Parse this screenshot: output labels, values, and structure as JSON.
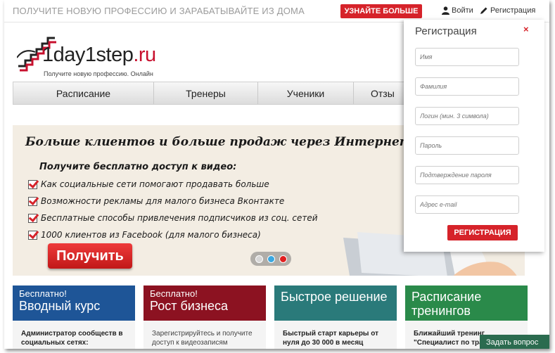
{
  "topbar": {
    "tagline": "ПОЛУЧИТЕ НОВУЮ ПРОФЕССИЮ И ЗАРАБАТЫВАЙТЕ ИЗ ДОМА",
    "cta_label": "УЗНАЙТЕ БОЛЬШЕ",
    "login_label": "Войти",
    "register_label": "Регистрация"
  },
  "logo": {
    "brand_main": "1day1step",
    "brand_suffix": ".ru",
    "slogan": "Получите новую профессию. Онлайн"
  },
  "nav": {
    "items": [
      "Расписание",
      "Тренеры",
      "Ученики",
      "Отзы"
    ]
  },
  "banner": {
    "headline": "Больше клиентов и больше продаж через Интернет",
    "subheadline": "Получите бесплатно доступ к видео:",
    "bullets": [
      "Как социальные сети помогают продавать больше",
      "Возможности рекламы для малого бизнеса Вконтакте",
      "Бесплатные способы привлечения подписчиков из соц. сетей",
      "1000 клиентов из Facebook (для малого бизнеса)"
    ],
    "button_label": "Получить",
    "slider_dot_colors": [
      "#d7d7d7",
      "#3aa7e0",
      "#e02020"
    ]
  },
  "cards": [
    {
      "small": "Бесплатно!",
      "big": "Вводный курс",
      "text": "Администратор сообществ в социальных сетях:",
      "color": "#1e5597"
    },
    {
      "small": "Бесплатно!",
      "big": "Рост бизнеса",
      "text": "Зарегистрируйтесь и получите доступ к видеозаписям",
      "color": "#8c1221"
    },
    {
      "small": "",
      "big": "Быстрое решение",
      "text": "Быстрый старт карьеры от нуля до 30 000 в месяц",
      "color": "#2a7a7a"
    },
    {
      "small": "",
      "big": "Расписание тренингов",
      "text": "Ближайший тренинг \"Специалист по траф",
      "color": "#2a8a4a"
    }
  ],
  "registration": {
    "title": "Регистрация",
    "close_glyph": "×",
    "fields": [
      {
        "name": "first-name",
        "placeholder": "Имя"
      },
      {
        "name": "last-name",
        "placeholder": "Фамилия"
      },
      {
        "name": "login",
        "placeholder": "Логин (мин. 3 символа)"
      },
      {
        "name": "password",
        "placeholder": "Пароль"
      },
      {
        "name": "password-confirm",
        "placeholder": "Подтверждение пароля"
      },
      {
        "name": "email",
        "placeholder": "Адрес e-mail"
      }
    ],
    "submit_label": "РЕГИСТРАЦИЯ"
  },
  "chat": {
    "label": "Задать вопрос"
  },
  "colors": {
    "accent_red": "#d6232a",
    "nav_bg": "#e6e6e6"
  }
}
